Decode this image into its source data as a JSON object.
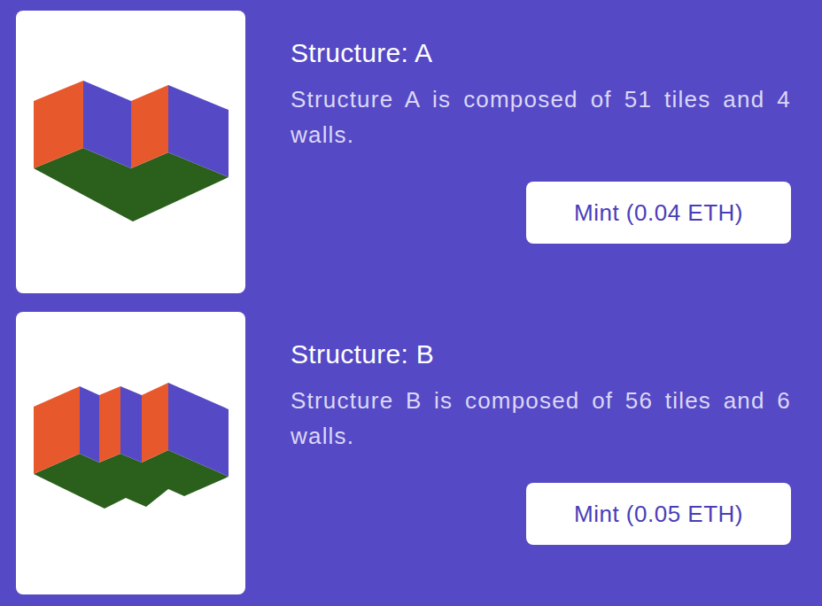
{
  "structures": [
    {
      "title": "Structure: A",
      "description": "Structure A is composed of 51 tiles and 4 walls.",
      "button": "Mint (0.04 ETH)"
    },
    {
      "title": "Structure: B",
      "description": "Structure B is composed of 56 tiles and 6 walls.",
      "button": "Mint (0.05 ETH)"
    }
  ]
}
